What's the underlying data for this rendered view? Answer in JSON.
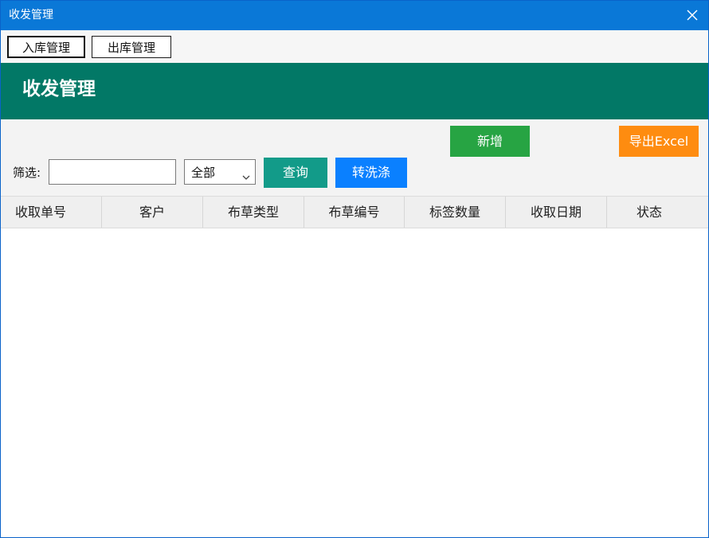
{
  "window": {
    "title": "收发管理"
  },
  "tabs": [
    {
      "label": "入库管理",
      "active": true
    },
    {
      "label": "出库管理",
      "active": false
    }
  ],
  "header": {
    "title": "收发管理",
    "color": "#027866"
  },
  "toolbar": {
    "add_label": "新增",
    "export_label": "导出Excel",
    "filter_label": "筛选:",
    "filter_input_value": "",
    "filter_select_value": "全部",
    "query_label": "查询",
    "wash_label": "转洗涤"
  },
  "colors": {
    "titlebar": "#0a78d7",
    "add": "#27a443",
    "export": "#fe8c10",
    "query": "#129b89",
    "wash": "#0a80ff"
  },
  "table": {
    "columns": [
      "收取单号",
      "客户",
      "布草类型",
      "布草编号",
      "标签数量",
      "收取日期",
      "状态"
    ],
    "rows": []
  },
  "icons": {
    "close": "close-icon",
    "dropdown": "chevron-down-icon"
  }
}
